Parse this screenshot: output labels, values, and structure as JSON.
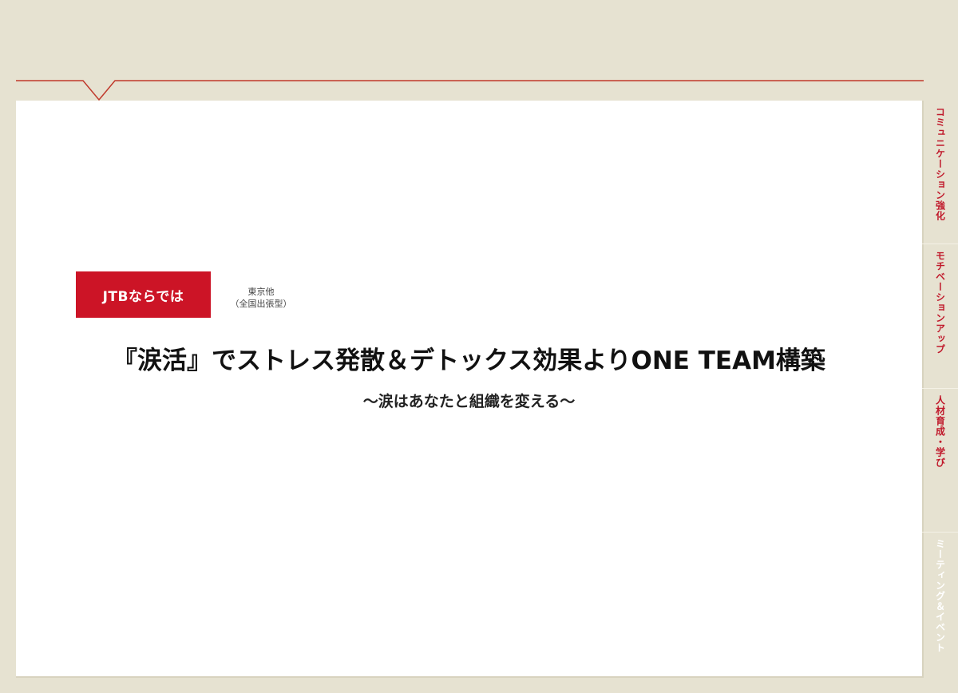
{
  "tag": {
    "label": "JTBならでは"
  },
  "location": {
    "line1": "東京他",
    "line2": "（全国出張型）"
  },
  "title": "『涙活』でストレス発散＆デトックス効果よりONE TEAM構築",
  "subtitle": "～涙はあなたと組織を変える～",
  "side_nav": {
    "items": [
      {
        "label": "コミュニケーション強化",
        "active": false
      },
      {
        "label": "モチベーションアップ",
        "active": false
      },
      {
        "label": "人材育成・学び",
        "active": false
      },
      {
        "label": "ミーティング＆イベント",
        "active": true
      }
    ]
  },
  "colors": {
    "background": "#e6e2d1",
    "accent_red": "#cc1426",
    "rule_line": "#c0392b",
    "panel": "#ffffff"
  }
}
